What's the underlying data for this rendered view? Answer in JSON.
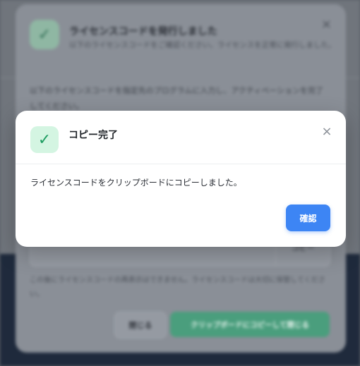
{
  "underlying_dialog": {
    "title": "ライセンスコードを発行しました",
    "subtitle": "以下のライセンスコードをご確認ください。ライセンスを正常に発行しました。",
    "close_glyph": "×",
    "description": "以下のライセンスコードを指定先のプログラムに入力し、アクティベーションを完了してください。",
    "field_button_label": "コピー",
    "note": "この後にライセンスコードの再表示はできません。ライセンスコードは大切に保管してください。",
    "close_button_label": "閉じる",
    "primary_button_label": "クリップボードにコピーして閉じる",
    "icon": "check-icon"
  },
  "modal": {
    "icon": "check-icon",
    "icon_glyph": "✓",
    "title": "コピー完了",
    "close_glyph": "×",
    "message": "ライセンスコードをクリップボードにコピーしました。",
    "confirm_label": "確認"
  },
  "colors": {
    "accent_blue": "#3d85f4",
    "success_green": "#1f9d62",
    "success_bg": "#d4f5e2"
  }
}
